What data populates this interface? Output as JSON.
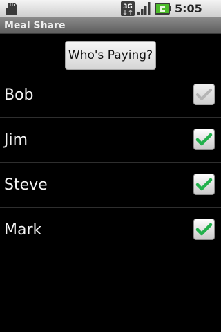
{
  "status_bar": {
    "time": "5:05 AM",
    "network_label": "3G",
    "icons": [
      "sd-card-icon",
      "3g-icon",
      "signal-icon",
      "battery-charging-icon"
    ]
  },
  "app": {
    "title": "Meal Share"
  },
  "main": {
    "pay_button_label": "Who's Paying?",
    "people": [
      {
        "name": "Bob",
        "checked": true,
        "enabled": false
      },
      {
        "name": "Jim",
        "checked": true,
        "enabled": true
      },
      {
        "name": "Steve",
        "checked": true,
        "enabled": true
      },
      {
        "name": "Mark",
        "checked": true,
        "enabled": true
      }
    ]
  },
  "colors": {
    "background": "#000000",
    "check_green": "#22b14c",
    "check_disabled": "#b5b5b5"
  }
}
